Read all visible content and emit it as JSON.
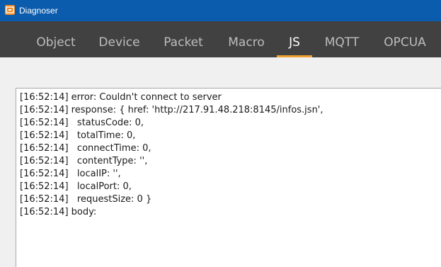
{
  "window": {
    "title": "Diagnoser",
    "icon": "app-icon"
  },
  "tabs": [
    {
      "label": "Object",
      "active": false
    },
    {
      "label": "Device",
      "active": false
    },
    {
      "label": "Packet",
      "active": false
    },
    {
      "label": "Macro",
      "active": false
    },
    {
      "label": "JS",
      "active": true
    },
    {
      "label": "MQTT",
      "active": false
    },
    {
      "label": "OPCUA",
      "active": false
    }
  ],
  "log": [
    "[16:52:14] error: Couldn't connect to server",
    "[16:52:14] response: { href: 'http://217.91.48.218:8145/infos.jsn',",
    "[16:52:14]   statusCode: 0,",
    "[16:52:14]   totalTime: 0,",
    "[16:52:14]   connectTime: 0,",
    "[16:52:14]   contentType: '',",
    "[16:52:14]   localIP: '',",
    "[16:52:14]   localPort: 0,",
    "[16:52:14]   requestSize: 0 }",
    "[16:52:14] body:"
  ],
  "colors": {
    "titlebar": "#0b5cad",
    "tabbar": "#414141",
    "accent": "#f0a030",
    "app_icon": "#f08a24"
  }
}
